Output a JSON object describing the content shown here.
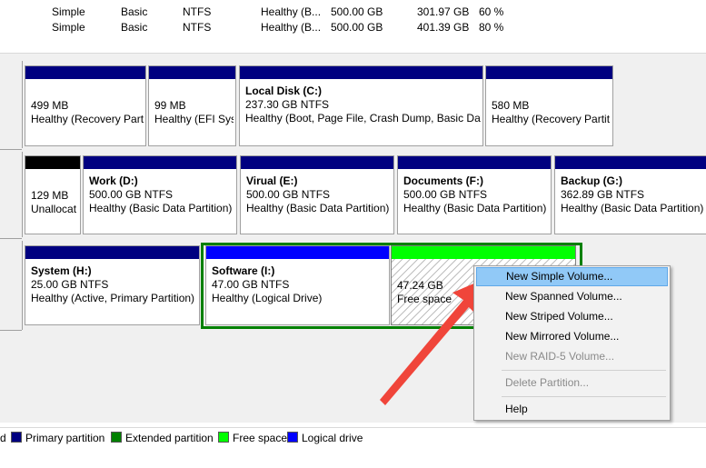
{
  "volumes": [
    {
      "layout": "Simple",
      "type": "Basic",
      "fs": "NTFS",
      "status": "Healthy (B...",
      "capacity": "500.00 GB",
      "free": "301.97 GB",
      "pct": "60 %"
    },
    {
      "layout": "Simple",
      "type": "Basic",
      "fs": "NTFS",
      "status": "Healthy (B...",
      "capacity": "500.00 GB",
      "free": "401.39 GB",
      "pct": "80 %"
    }
  ],
  "disk0": [
    {
      "name": "",
      "size": "499 MB",
      "status": "Healthy (Recovery Part"
    },
    {
      "name": "",
      "size": "99 MB",
      "status": "Healthy (EFI Syst"
    },
    {
      "name": "Local Disk  (C:)",
      "size": "237.30 GB NTFS",
      "status": "Healthy (Boot, Page File, Crash Dump, Basic Data"
    },
    {
      "name": "",
      "size": "580 MB",
      "status": "Healthy (Recovery Partit"
    }
  ],
  "disk1": [
    {
      "name": "",
      "size": "129 MB",
      "status": "Unallocat"
    },
    {
      "name": "Work  (D:)",
      "size": "500.00 GB NTFS",
      "status": "Healthy (Basic Data Partition)"
    },
    {
      "name": "Virual  (E:)",
      "size": "500.00 GB NTFS",
      "status": "Healthy (Basic Data Partition)"
    },
    {
      "name": "Documents  (F:)",
      "size": "500.00 GB NTFS",
      "status": "Healthy (Basic Data Partition)"
    },
    {
      "name": "Backup  (G:)",
      "size": "362.89 GB NTFS",
      "status": "Healthy (Basic Data Partition)"
    }
  ],
  "disk2": [
    {
      "name": "System  (H:)",
      "size": "25.00 GB NTFS",
      "status": "Healthy (Active, Primary Partition)"
    },
    {
      "name": "Software  (I:)",
      "size": "47.00 GB NTFS",
      "status": "Healthy (Logical Drive)"
    },
    {
      "name": "",
      "size": "47.24 GB",
      "status": "Free space"
    }
  ],
  "context_menu": {
    "items": [
      {
        "label": "New Simple Volume...",
        "enabled": true,
        "highlighted": true
      },
      {
        "label": "New Spanned Volume...",
        "enabled": true
      },
      {
        "label": "New Striped Volume...",
        "enabled": true
      },
      {
        "label": "New Mirrored Volume...",
        "enabled": true
      },
      {
        "label": "New RAID-5 Volume...",
        "enabled": false
      },
      {
        "label": "Delete Partition...",
        "enabled": false
      },
      {
        "label": "Help",
        "enabled": true
      }
    ]
  },
  "legend": [
    {
      "label": "d",
      "color": ""
    },
    {
      "label": "Primary partition",
      "color": "#000080"
    },
    {
      "label": "Extended partition",
      "color": "#008000"
    },
    {
      "label": "Free space",
      "color": "#00ff00"
    },
    {
      "label": "Logical drive",
      "color": "#0000ff"
    }
  ],
  "colors": {
    "primary": "#000080",
    "extended": "#008000",
    "free": "#00ff00",
    "logical": "#0000ff",
    "unallocated": "#000000",
    "arrow": "#f0453a"
  }
}
